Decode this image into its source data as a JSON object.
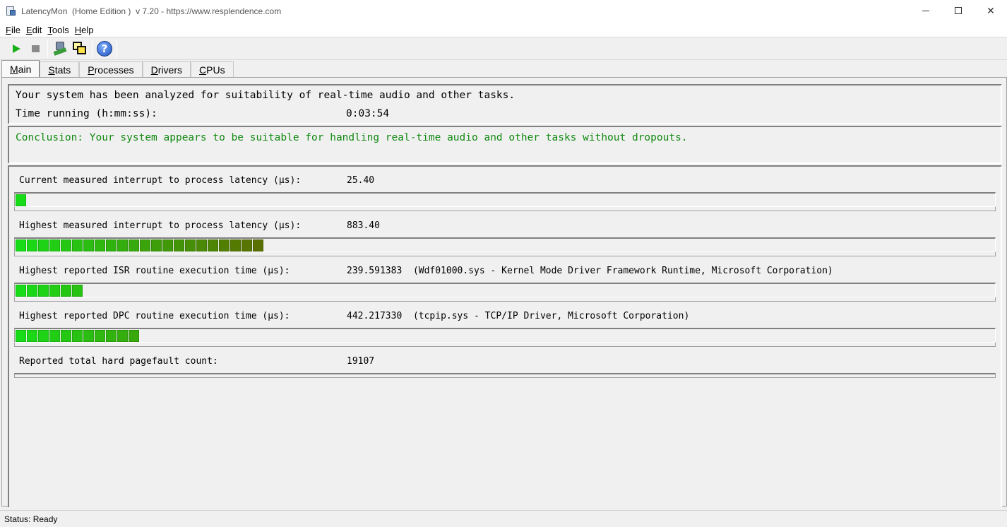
{
  "window": {
    "app_name": "LatencyMon",
    "edition": "(Home Edition )",
    "version_url": "v 7.20 - https://www.resplendence.com",
    "controls": {
      "minimize": "",
      "maximize": "",
      "close": "✕"
    }
  },
  "menu": [
    {
      "underline": "F",
      "rest": "ile"
    },
    {
      "underline": "E",
      "rest": "dit"
    },
    {
      "underline": "T",
      "rest": "ools"
    },
    {
      "underline": "H",
      "rest": "elp"
    }
  ],
  "toolbar": {
    "icons": [
      "play-icon",
      "stop-icon",
      "tools-icon",
      "windows-icon",
      "help-icon"
    ],
    "help_glyph": "?"
  },
  "tabs": [
    {
      "underline": "M",
      "rest": "ain",
      "active": true
    },
    {
      "underline": "S",
      "rest": "tats",
      "active": false
    },
    {
      "underline": "P",
      "rest": "rocesses",
      "active": false
    },
    {
      "underline": "D",
      "rest": "rivers",
      "active": false
    },
    {
      "underline": "C",
      "rest": "PUs",
      "active": false
    }
  ],
  "main": {
    "summary": "Your system has been analyzed for suitability of real-time audio and other tasks.",
    "time_running_label": "Time running (h:mm:ss):",
    "time_running_value": "0:03:54",
    "conclusion": "Conclusion: Your system appears to be suitable for handling real-time audio and other tasks without dropouts.",
    "conclusion_color": "#138a13",
    "metrics": [
      {
        "label": "Current measured interrupt to process latency (µs):",
        "value": "25.40",
        "detail": "",
        "bar_segments": 1
      },
      {
        "label": "Highest measured interrupt to process latency (µs):",
        "value": "883.40",
        "detail": "",
        "bar_segments": 22
      },
      {
        "label": "Highest reported ISR routine execution time (µs):",
        "value": "239.591383",
        "detail": "(Wdf01000.sys - Kernel Mode Driver Framework Runtime, Microsoft Corporation)",
        "bar_segments": 6
      },
      {
        "label": "Highest reported DPC routine execution time (µs):",
        "value": "442.217330",
        "detail": "(tcpip.sys - TCP/IP Driver, Microsoft Corporation)",
        "bar_segments": 11
      },
      {
        "label": "Reported total hard pagefault count:",
        "value": "19107",
        "detail": "",
        "bar_segments": 0
      }
    ]
  },
  "status": {
    "text": "Status: Ready"
  }
}
